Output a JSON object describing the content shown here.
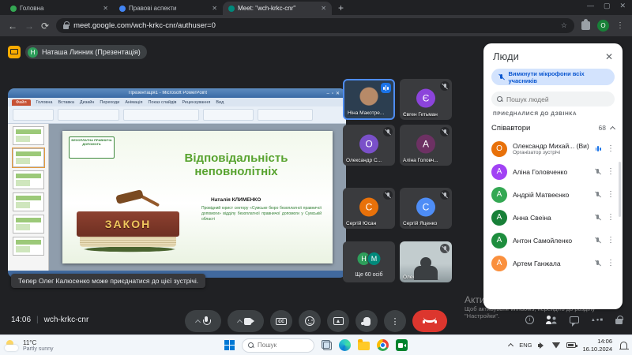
{
  "browser": {
    "tabs": [
      {
        "title": "Головна"
      },
      {
        "title": "Правові аспекти"
      },
      {
        "title": "Meet: \"wch-krkc-cnr\""
      }
    ],
    "url": "meet.google.com/wch-krkc-cnr/authuser=0",
    "profile_initial": "О"
  },
  "meet": {
    "presenter": {
      "initial": "Н",
      "label": "Наташа Линник (Презентація)"
    },
    "toast": "Тепер Олег Калюсенко може приєднатися до цієї зустрічі.",
    "time": "14:06",
    "code": "wch-krkc-cnr",
    "tiles": [
      {
        "name": "Ніна Макотре..."
      },
      {
        "name": "Євген Гетьман",
        "initial": "Є",
        "color": "#8c44db"
      },
      {
        "name": "Олександр С...",
        "initial": "О",
        "color": "#7a50c9"
      },
      {
        "name": "Аліна Головч...",
        "initial": "А",
        "color": "#6d3163"
      },
      {
        "name": "Сергій Юсан",
        "initial": "С",
        "color": "#e8710a"
      },
      {
        "name": "Сергій Яценко",
        "initial": "С",
        "color": "#4e8df6"
      },
      {
        "name": "Ще 60 осіб",
        "initial_a": "Н",
        "initial_b": "М",
        "color_a": "#2e9e5b",
        "color_b": "#00897b"
      },
      {
        "name": "Олександр М..."
      }
    ],
    "panel": {
      "title": "Люди",
      "mute_all": "Вимкнути мікрофони всіх учасників",
      "search_placeholder": "Пошук людей",
      "section": "ПРИЄДНАЛИСЯ ДО ДЗВІНКА",
      "group_label": "Співавтори",
      "group_count": "68",
      "participants": [
        {
          "name": "Олександр Михай... (Ви)",
          "subtitle": "Організатор зустрічі",
          "initial": "О",
          "color": "#e8710a"
        },
        {
          "name": "Аліна Головченко",
          "initial": "А",
          "color": "#a142f4"
        },
        {
          "name": "Андрій Матвеєнко",
          "initial": "А",
          "color": "#34a853"
        },
        {
          "name": "Анна Свеіна",
          "initial": "А",
          "color": "#188038"
        },
        {
          "name": "Антон Самойленко",
          "initial": "А",
          "color": "#1e8e3e"
        },
        {
          "name": "Артем Ганжала",
          "initial": "А",
          "color": "#fa903e"
        }
      ]
    }
  },
  "presentation": {
    "window_title": "Презентація1 - Microsoft PowerPoint",
    "ribbon_tabs": [
      "Файл",
      "Головна",
      "Вставка",
      "Дизайн",
      "Переходи",
      "Анімація",
      "Показ слайдів",
      "Рецензування",
      "Вид"
    ],
    "slide": {
      "logo": "БЕЗОПЛАТНА ПРАВНИЧА ДОПОМОГА",
      "title_line1": "Відповідальність",
      "title_line2": "неповнолітніх",
      "book": "ЗАКОН",
      "author": "Наталія КЛИМЕНКО",
      "body": "Провідний юрист сектору «Сумське бюро безоплатної правничої допомоги» відділу безоплатної правничої допомоги у Сумській області"
    }
  },
  "watermark": {
    "line1": "Активація Windows",
    "line2": "Щоб активувати Windows, перейдіть до розділу",
    "line3": "\"Настройки\"."
  },
  "taskbar": {
    "weather_temp": "11°C",
    "weather_desc": "Partly sunny",
    "search": "Пошук",
    "lang": "ENG",
    "time": "14:06",
    "date": "16.10.2024"
  }
}
